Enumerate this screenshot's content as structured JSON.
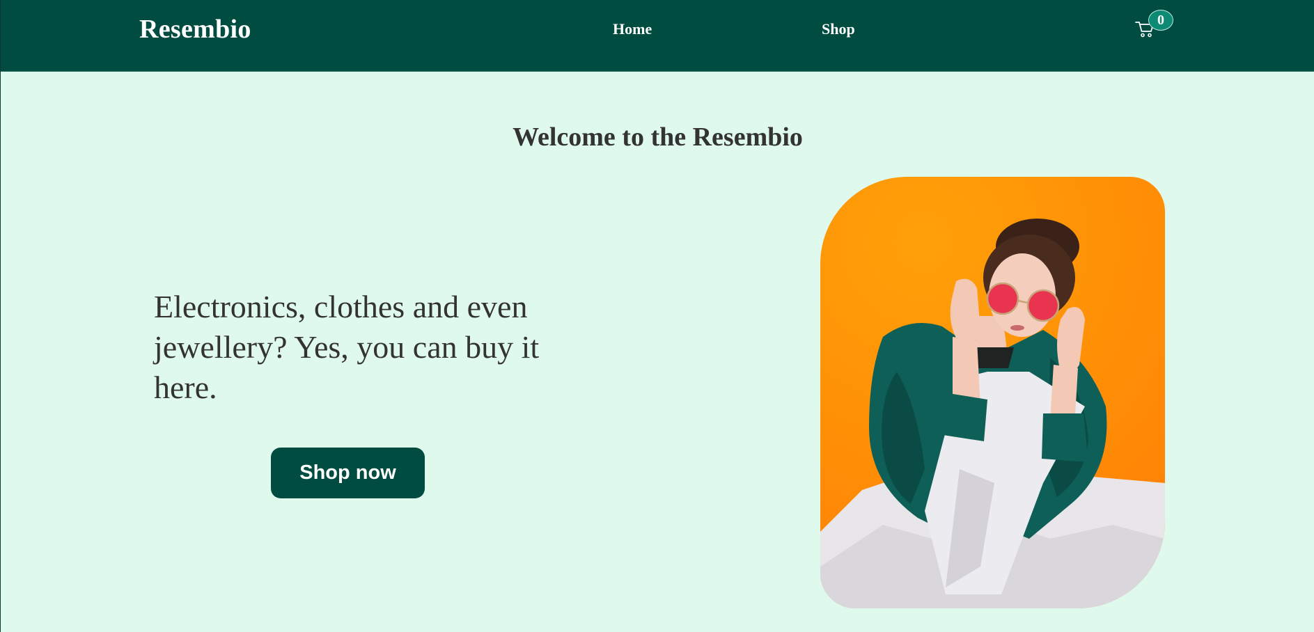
{
  "header": {
    "brand": "Resembio",
    "nav": [
      {
        "label": "Home"
      },
      {
        "label": "Shop"
      }
    ],
    "cart": {
      "icon": "cart-icon",
      "count": "0"
    }
  },
  "main": {
    "welcome": "Welcome to the Resembio",
    "tagline": "Electronics, clothes and even jewellery? Yes, you can buy it here.",
    "cta_label": "Shop now",
    "hero_image": {
      "icon": "hero-photo"
    }
  },
  "colors": {
    "nav_bg": "#004c40",
    "page_bg": "#dffaed",
    "badge_bg": "#0c8a74",
    "text": "#333333",
    "hero_bg": "#ff8d06"
  }
}
